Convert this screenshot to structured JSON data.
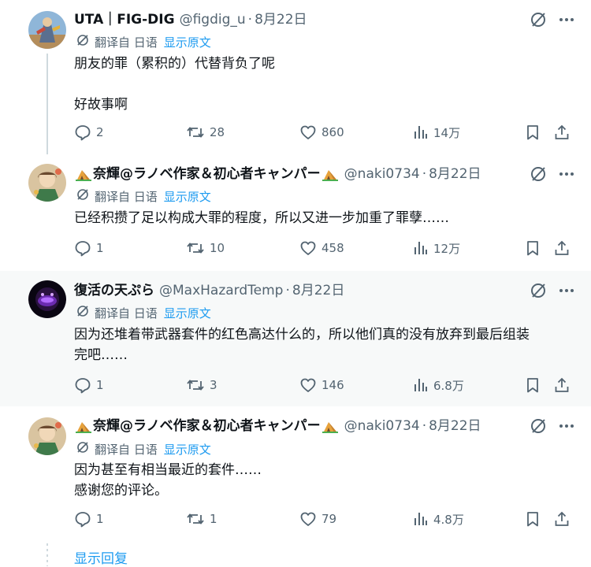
{
  "translate": {
    "label": "翻译自 日语",
    "show_original": "显示原文"
  },
  "show_replies": "显示回复",
  "posts": [
    {
      "name": "UTA｜FIG-DIG",
      "handle": "@figdig_u",
      "date": "8月22日",
      "lines": [
        "朋友的罪（累积的）代替背负了呢",
        "",
        "好故事啊"
      ],
      "stats": {
        "replies": "2",
        "reposts": "28",
        "likes": "860",
        "views": "14万"
      }
    },
    {
      "name": "奈輝@ラノベ作家＆初心者キャンパー",
      "handle": "@naki0734",
      "date": "8月22日",
      "lines": [
        "已经积攒了足以构成大罪的程度，所以又进一步加重了罪孽……"
      ],
      "stats": {
        "replies": "1",
        "reposts": "10",
        "likes": "458",
        "views": "12万"
      }
    },
    {
      "name": "復活の天ぷら",
      "handle": "@MaxHazardTemp",
      "date": "8月22日",
      "lines": [
        "因为还堆着带武器套件的红色高达什么的，所以他们真的没有放弃到最后组装",
        "完吧……"
      ],
      "stats": {
        "replies": "1",
        "reposts": "3",
        "likes": "146",
        "views": "6.8万"
      }
    },
    {
      "name": "奈輝@ラノベ作家＆初心者キャンパー",
      "handle": "@naki0734",
      "date": "8月22日",
      "lines": [
        "因为甚至有相当最近的套件……",
        "感谢您的评论。"
      ],
      "stats": {
        "replies": "1",
        "reposts": "1",
        "likes": "79",
        "views": "4.8万"
      }
    }
  ]
}
